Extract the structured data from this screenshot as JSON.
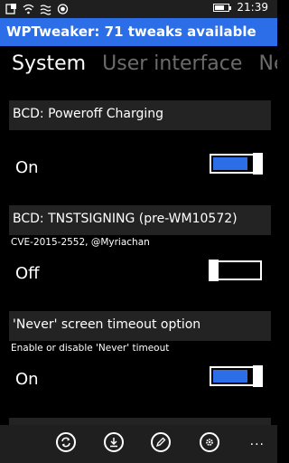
{
  "status_bar": {
    "time": "21:39",
    "battery_level_percent": 70,
    "icons": [
      "notification-icon",
      "wifi-icon",
      "signal-icon",
      "record-icon"
    ]
  },
  "app": {
    "title": "WPTweaker: 71 tweaks available",
    "accent_color": "#2b6ee8"
  },
  "pivot": {
    "tabs": [
      {
        "label": "System",
        "active": true
      },
      {
        "label": "User interface",
        "active": false
      },
      {
        "label": "Netwo",
        "active": false
      }
    ]
  },
  "settings": [
    {
      "title": "BCD: Poweroff Charging",
      "description": "",
      "state": "On",
      "enabled": true
    },
    {
      "title": "BCD: TNSTSIGNING (pre-WM10572)",
      "description": "CVE-2015-2552, @Myriachan",
      "state": "Off",
      "enabled": false
    },
    {
      "title": "'Never' screen timeout option",
      "description": "Enable or disable 'Never' timeout",
      "state": "On",
      "enabled": true
    }
  ],
  "app_bar": {
    "buttons": [
      {
        "name": "refresh-icon"
      },
      {
        "name": "download-icon"
      },
      {
        "name": "edit-icon"
      },
      {
        "name": "settings-icon"
      }
    ],
    "more_label": "..."
  }
}
